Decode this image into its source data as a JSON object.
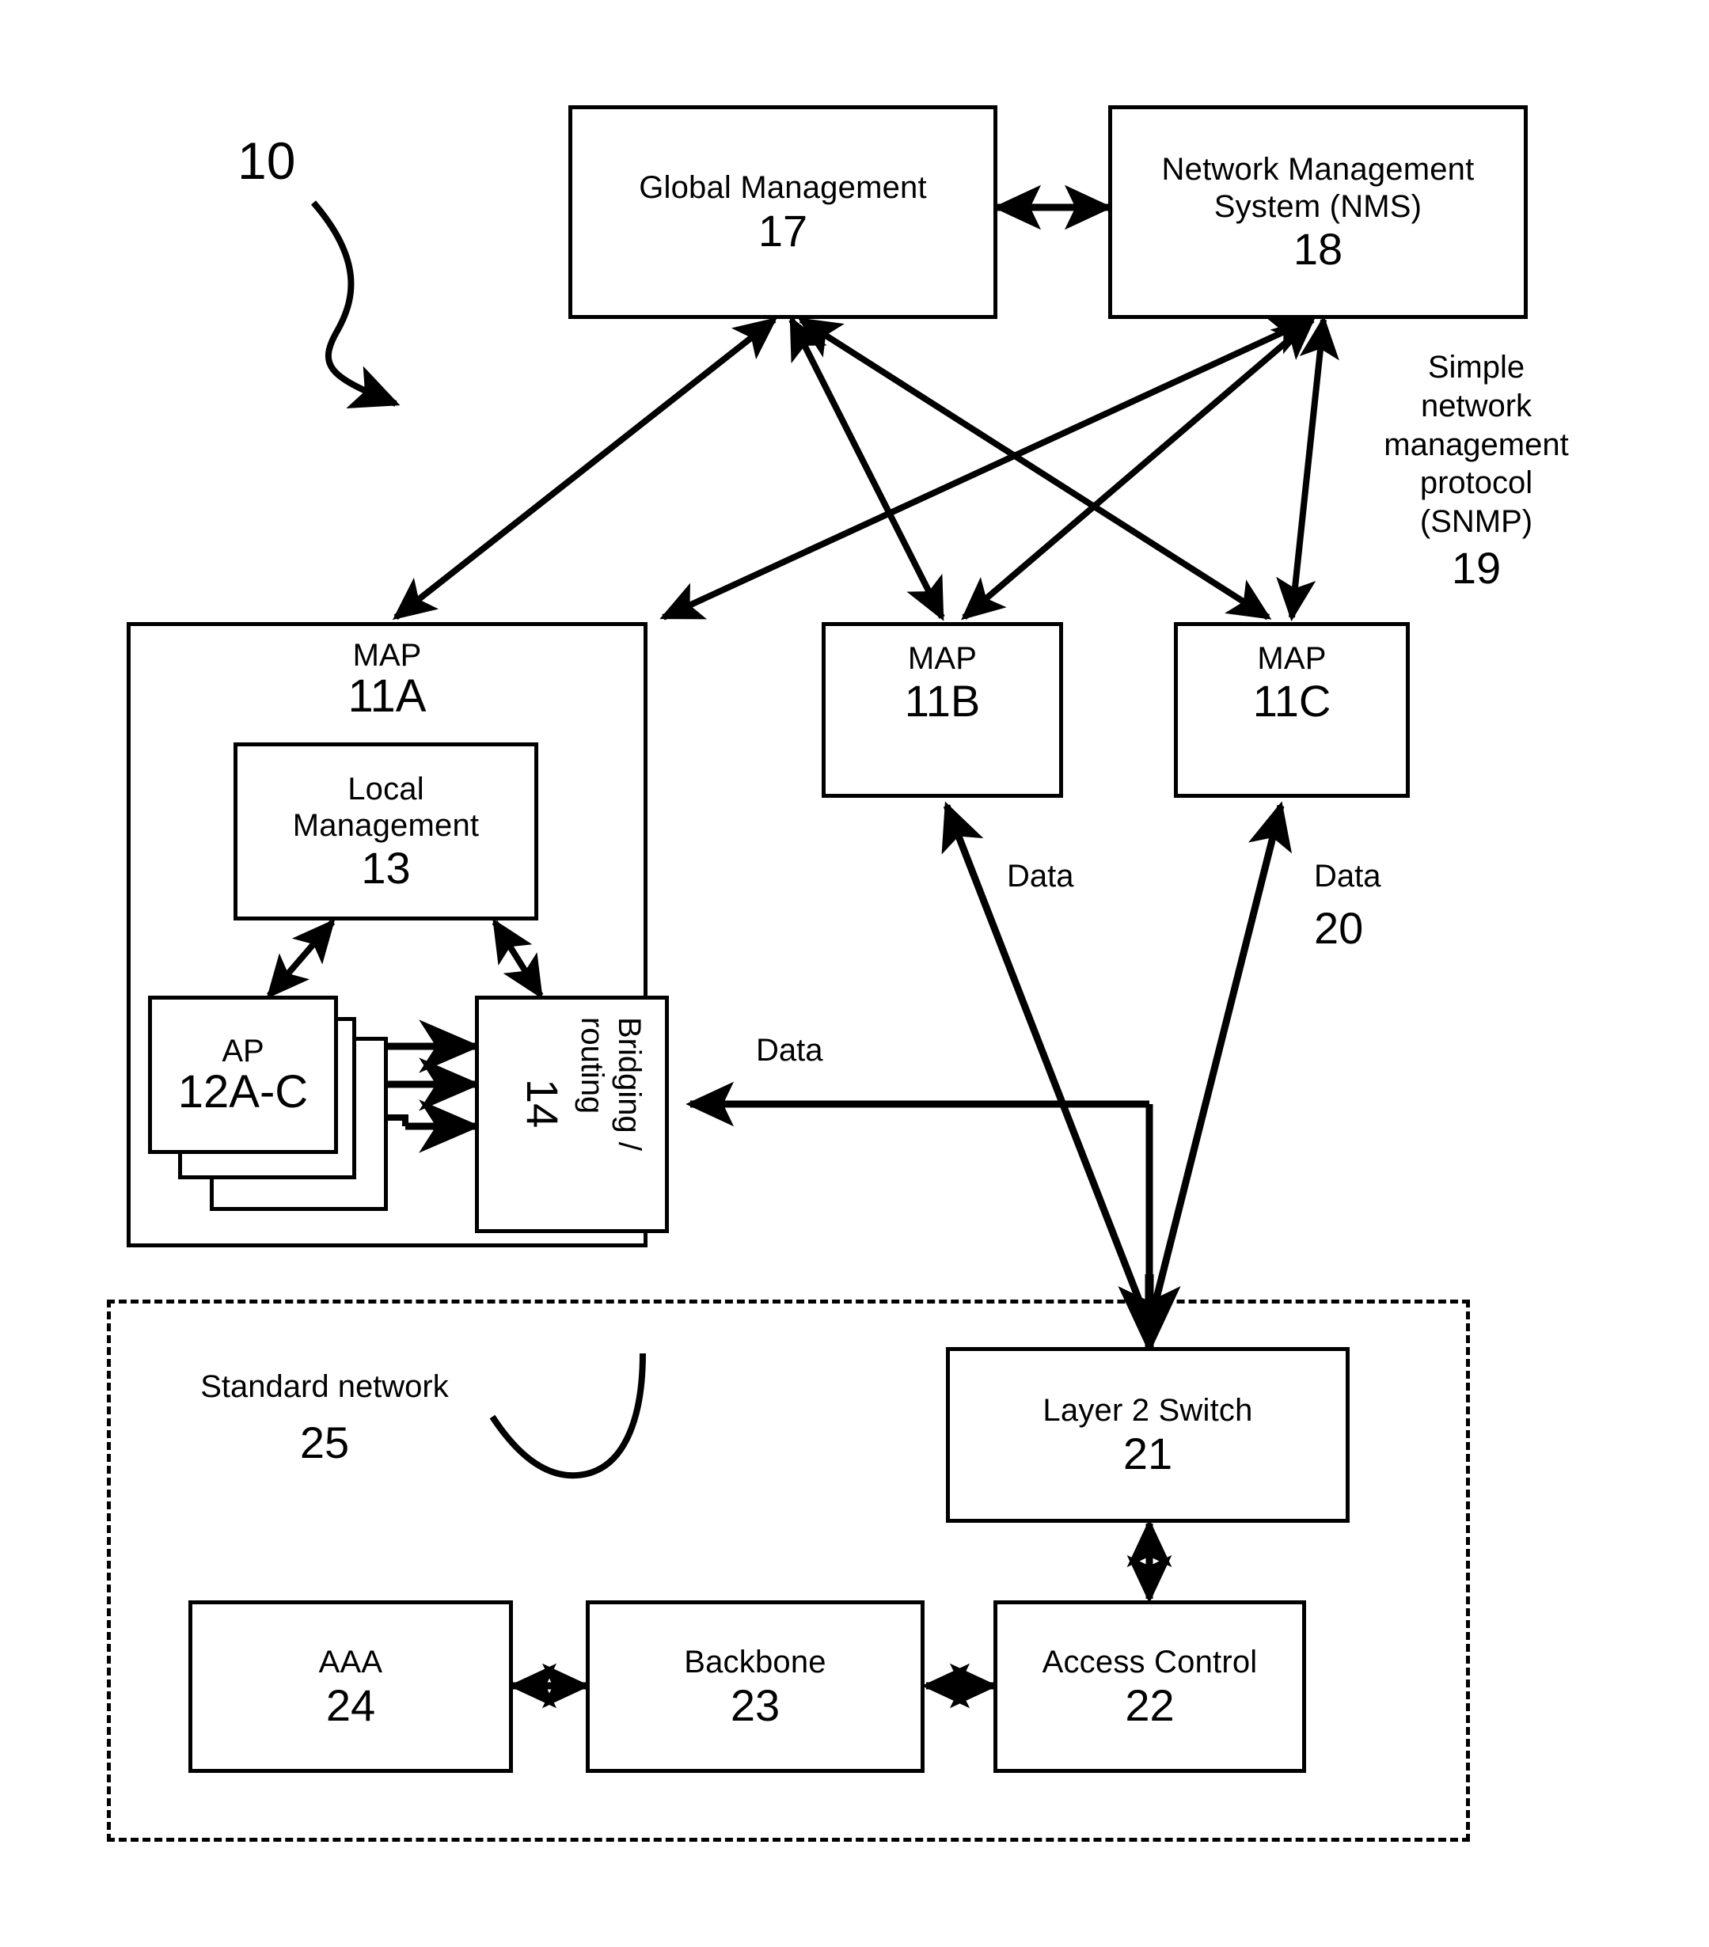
{
  "figure": {
    "ref_number": "10"
  },
  "top_boxes": [
    {
      "title": "Global Management",
      "num": "17"
    },
    {
      "title": "Network Management\nSystem (NMS)",
      "title_line1": "Network Management",
      "title_line2": "System (NMS)",
      "num": "18"
    }
  ],
  "snmp_annotation": {
    "line1": "Simple",
    "line2": "network",
    "line3": "management",
    "line4": "protocol",
    "line5": "(SNMP)",
    "num": "19"
  },
  "maps": [
    {
      "title": "MAP",
      "num": "11A"
    },
    {
      "title": "MAP",
      "num": "11B"
    },
    {
      "title": "MAP",
      "num": "11C"
    }
  ],
  "map_a_internals": {
    "local_management": {
      "line1": "Local",
      "line2": "Management",
      "num": "13"
    },
    "ap": {
      "title": "AP",
      "num": "12A-C"
    },
    "bridging": {
      "title": "Bridging /\nrouting",
      "title_line1": "Bridging /",
      "title_line2": "routing",
      "num": "14"
    }
  },
  "data_labels": {
    "to_map_b": "Data",
    "to_map_c": "Data",
    "to_map_c_num": "20",
    "to_bridging": "Data"
  },
  "standard_network": {
    "title": "Standard network",
    "num": "25"
  },
  "network_boxes": [
    {
      "title": "Layer 2 Switch",
      "num": "21"
    },
    {
      "title": "Access Control",
      "num": "22"
    },
    {
      "title": "Backbone",
      "num": "23"
    },
    {
      "title": "AAA",
      "num": "24"
    }
  ],
  "colors": {
    "stroke": "#000000",
    "background": "#ffffff"
  }
}
